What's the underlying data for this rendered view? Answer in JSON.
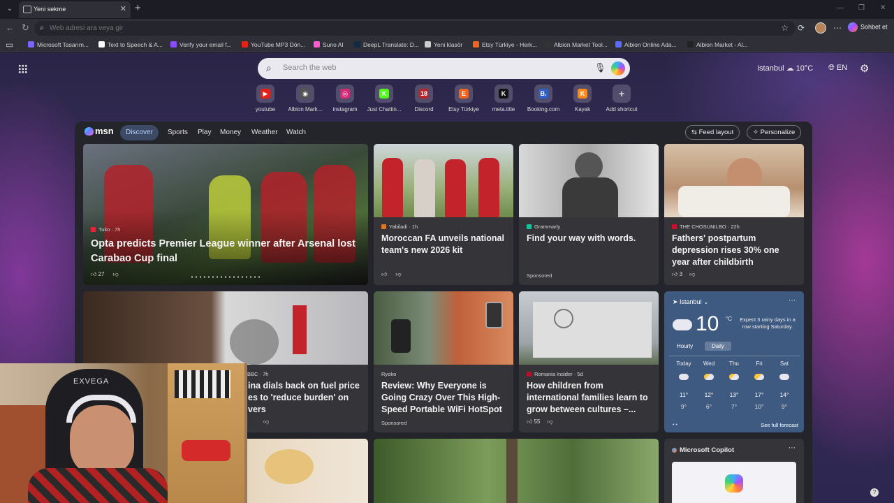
{
  "browser": {
    "tab_title": "Yeni sekme",
    "address_placeholder": "Web adresi ara veya gir",
    "chat_label": "Sohbet et"
  },
  "bookmarks": [
    {
      "label": "Microsoft Tasarım...",
      "color": "#7b63ff"
    },
    {
      "label": "Text to Speech & A...",
      "color": "#ffffff"
    },
    {
      "label": "Verify your email f...",
      "color": "#8a4dff"
    },
    {
      "label": "YouTube MP3 Dön...",
      "color": "#e62117"
    },
    {
      "label": "Suno AI",
      "color": "#ff5ad0"
    },
    {
      "label": "DeepL Translate: D...",
      "color": "#0f2b46"
    },
    {
      "label": "Yeni klasör",
      "color": "#cfcfcf"
    },
    {
      "label": "Etsy Türkiye - Herk...",
      "color": "#f1641e"
    },
    {
      "label": "Albion Market Tool...",
      "color": "#333333"
    },
    {
      "label": "Albion Online Ada...",
      "color": "#5a6bff"
    },
    {
      "label": "Albion Market - Al...",
      "color": "#222222"
    }
  ],
  "newtab": {
    "search_placeholder": "Search the web",
    "location": "Istanbul",
    "temp": "10°C",
    "language": "EN"
  },
  "shortcuts": [
    {
      "label": "youtube",
      "color": "#e62117",
      "glyph": "▶"
    },
    {
      "label": "Albion Mark...",
      "color": "#555555",
      "glyph": "◉"
    },
    {
      "label": "instagram",
      "color": "#d62976",
      "glyph": "◎"
    },
    {
      "label": "Just Chattin...",
      "color": "#53fc18",
      "glyph": "K"
    },
    {
      "label": "Discord",
      "color": "#b5272d",
      "glyph": "18"
    },
    {
      "label": "Etsy Türkiye",
      "color": "#f1641e",
      "glyph": "E"
    },
    {
      "label": "meta.title",
      "color": "#111111",
      "glyph": "K"
    },
    {
      "label": "Booking.com",
      "color": "#2f5fc9",
      "glyph": "B."
    },
    {
      "label": "Kayak",
      "color": "#ff8a1c",
      "glyph": "K"
    },
    {
      "label": "Add shortcut",
      "color": "transparent",
      "glyph": "+"
    }
  ],
  "feed_nav": [
    "Discover",
    "Sports",
    "Play",
    "Money",
    "Weather",
    "Watch"
  ],
  "feed_buttons": {
    "layout": "Feed layout",
    "personalize": "Personalize"
  },
  "cards": {
    "hero": {
      "source": "Tuko · 7h",
      "title": "Opta predicts Premier League winner after Arsenal lost Carabao Cup final",
      "likes": "27"
    },
    "c2": {
      "source": "Yabiladi · 1h",
      "title": "Moroccan FA unveils national team's new 2026 kit"
    },
    "c3": {
      "source": "Grammarly",
      "title": "Find your way with words.",
      "sponsored": "Sponsored"
    },
    "c4": {
      "source": "THE CHOSUNILBO · 22h",
      "title": "Fathers' postpartum depression rises 30% one year after childbirth",
      "likes": "3"
    },
    "c5": {
      "source": "BBC · 7h",
      "title": "ina dials back on fuel price es to 'reduce burden' on vers"
    },
    "c6": {
      "source": "Ryoko",
      "title": "Review: Why Everyone is Going Crazy Over This High-Speed Portable WiFi HotSpot",
      "sponsored": "Sponsored"
    },
    "c7": {
      "source": "Romania Insider · 5d",
      "title": "How children from international families learn to grow between cultures –...",
      "likes": "55"
    }
  },
  "weather": {
    "city": "Istanbul",
    "temp": "10",
    "unit": "°C",
    "note": "Expect 3 rainy days in a row starting Saturday.",
    "tabs": [
      "Hourly",
      "Daily"
    ],
    "days": [
      {
        "day": "Today",
        "hi": "11°",
        "lo": "9°"
      },
      {
        "day": "Wed",
        "hi": "12°",
        "lo": "6°"
      },
      {
        "day": "Thu",
        "hi": "13°",
        "lo": "7°"
      },
      {
        "day": "Fri",
        "hi": "17°",
        "lo": "10°"
      },
      {
        "day": "Sat",
        "hi": "14°",
        "lo": "9°"
      }
    ],
    "forecast_link": "See full forecast"
  },
  "copilot": {
    "title": "Microsoft Copilot"
  },
  "webcam": {
    "chair_brand": "EXVEGA"
  }
}
